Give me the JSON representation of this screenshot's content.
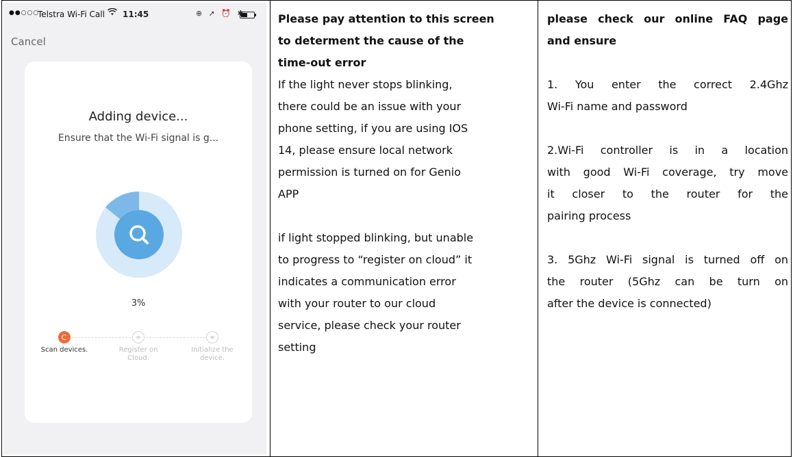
{
  "phone": {
    "status_bar": {
      "signal": "●●○○○",
      "carrier": "Telstra Wi-Fi Call",
      "wifi_icon": "wifi-icon",
      "time": "11:45",
      "icons": "⊕ ➚ ⏰ ✱",
      "battery_level": 0.5
    },
    "cancel_label": "Cancel",
    "card": {
      "title": "Adding device...",
      "subtitle": "Ensure that the Wi-Fi signal is g...",
      "progress_text": "3%",
      "progress_value": 0.03,
      "steps": [
        {
          "label": "Scan devices.",
          "active": true,
          "icon": "refresh-icon"
        },
        {
          "label": "Register on Cloud.",
          "active": false,
          "icon": "cloud-icon"
        },
        {
          "label": "Initialize the device.",
          "active": false,
          "icon": "gear-icon"
        }
      ]
    },
    "colors": {
      "accent_orange": "#ef6a3a",
      "radar_light": "#cfe6f8",
      "radar_mid": "#6fb3e6",
      "radar_core": "#57a7e0"
    }
  },
  "middle_column": {
    "heading_lines": [
      "Please pay attention to this screen",
      "to determent the cause of the",
      "time-out error"
    ],
    "paragraph1_lines": [
      "If the light never stops blinking,",
      "there could be an issue with your",
      "phone setting, if you are using IOS",
      "14, please ensure local network",
      "permission is turned on for Genio",
      "APP"
    ],
    "paragraph2_lines": [
      "if light stopped blinking, but unable",
      "to progress to “register on cloud” it",
      "indicates a communication error",
      "with your router to our cloud",
      "service, please check your router",
      "setting"
    ]
  },
  "right_column": {
    "heading_lines": [
      "please check our online FAQ page",
      "and ensure"
    ],
    "item1_lines": [
      "1. You enter the correct 2.4Ghz",
      "Wi-Fi name and password"
    ],
    "item2_lines": [
      "2.Wi-Fi controller is in a location",
      "with good Wi-Fi coverage, try move",
      "it closer to the router for the",
      "pairing process"
    ],
    "item3_lines": [
      "3. 5Ghz Wi-Fi signal is turned off on",
      "the router (5Ghz can be turn on",
      "after the device is connected)"
    ]
  }
}
